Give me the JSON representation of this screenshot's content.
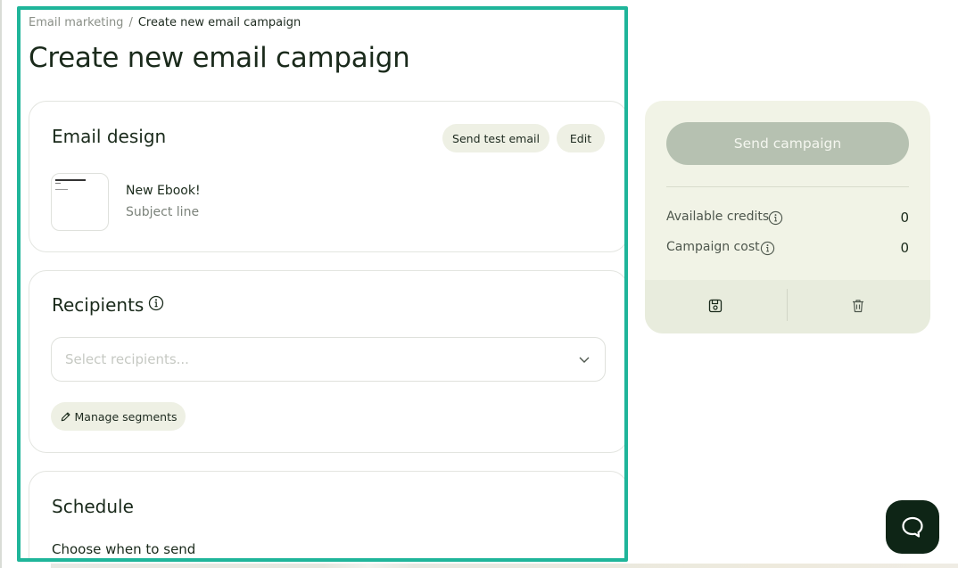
{
  "breadcrumb": {
    "parent": "Email marketing",
    "separator": "/",
    "current": "Create new email campaign"
  },
  "page_title": "Create new email campaign",
  "email_design": {
    "title": "Email design",
    "send_test_label": "Send test email",
    "edit_label": "Edit",
    "name": "New Ebook!",
    "subject": "Subject line"
  },
  "recipients": {
    "title": "Recipients",
    "placeholder": "Select recipients...",
    "manage_label": "Manage segments"
  },
  "schedule": {
    "title": "Schedule",
    "subtitle": "Choose when to send"
  },
  "side_panel": {
    "send_label": "Send campaign",
    "credits_label": "Available credits",
    "credits_value": "0",
    "cost_label": "Campaign cost",
    "cost_value": "0"
  },
  "icons": {
    "info": "info-icon",
    "chevron": "chevron-down-icon",
    "pencil": "pencil-icon",
    "save": "save-icon",
    "trash": "trash-icon",
    "chat": "chat-icon"
  },
  "colors": {
    "highlight": "#1fb59a",
    "panel_bg": "#f1f3e6",
    "send_button_disabled": "#b6c1b1",
    "pill_bg": "#eef0e4",
    "chat_button": "#0e2516"
  }
}
